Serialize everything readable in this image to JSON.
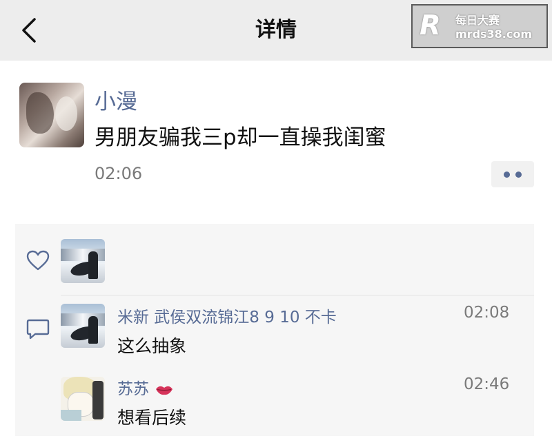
{
  "nav": {
    "title": "详情"
  },
  "watermark": {
    "logo": "R",
    "name": "每日大赛",
    "url": "mrds38.com"
  },
  "post": {
    "author": "小漫",
    "text": "男朋友骗我三p却一直操我闺蜜",
    "time": "02:06"
  },
  "comments": [
    {
      "author": "米新 武侯双流锦江8 9 10 不卡",
      "text": "这么抽象",
      "time": "02:08"
    },
    {
      "author": "苏苏",
      "text": "想看后续",
      "time": "02:46"
    }
  ],
  "icons": {
    "back": "chevron-left-icon",
    "more": "more-dots-icon",
    "like": "heart-icon",
    "comment": "comment-bubble-icon",
    "badge": "kiss-lips-icon"
  },
  "colors": {
    "nav_bg": "#ededed",
    "link_name": "#576b95",
    "panel_bg": "#f6f6f6"
  }
}
